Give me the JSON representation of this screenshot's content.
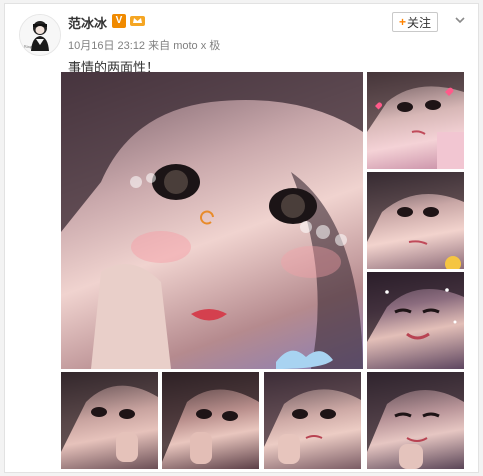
{
  "post": {
    "username": "范冰冰",
    "verified_badge": "V",
    "timestamp": "10月16日 23:12",
    "source_prefix": "来自",
    "source": "moto x 极",
    "text": "事情的两面性！"
  },
  "follow_button": {
    "label": "关注",
    "plus": "+"
  },
  "icons": {
    "avatar": "avatar-image",
    "verified": "verified-v-icon",
    "vip": "vip-crown-icon",
    "menu": "chevron-down-icon"
  },
  "colors": {
    "accent_orange": "#ff8200",
    "verified_orange": "#f08a00",
    "text_primary": "#333333",
    "text_meta": "#808080",
    "border": "#e2e2e2"
  },
  "photos": [
    {
      "name": "photo-main"
    },
    {
      "name": "photo-right-1"
    },
    {
      "name": "photo-right-2"
    },
    {
      "name": "photo-right-3"
    },
    {
      "name": "photo-bottom-1"
    },
    {
      "name": "photo-bottom-2"
    },
    {
      "name": "photo-bottom-3"
    },
    {
      "name": "photo-bottom-4"
    }
  ]
}
